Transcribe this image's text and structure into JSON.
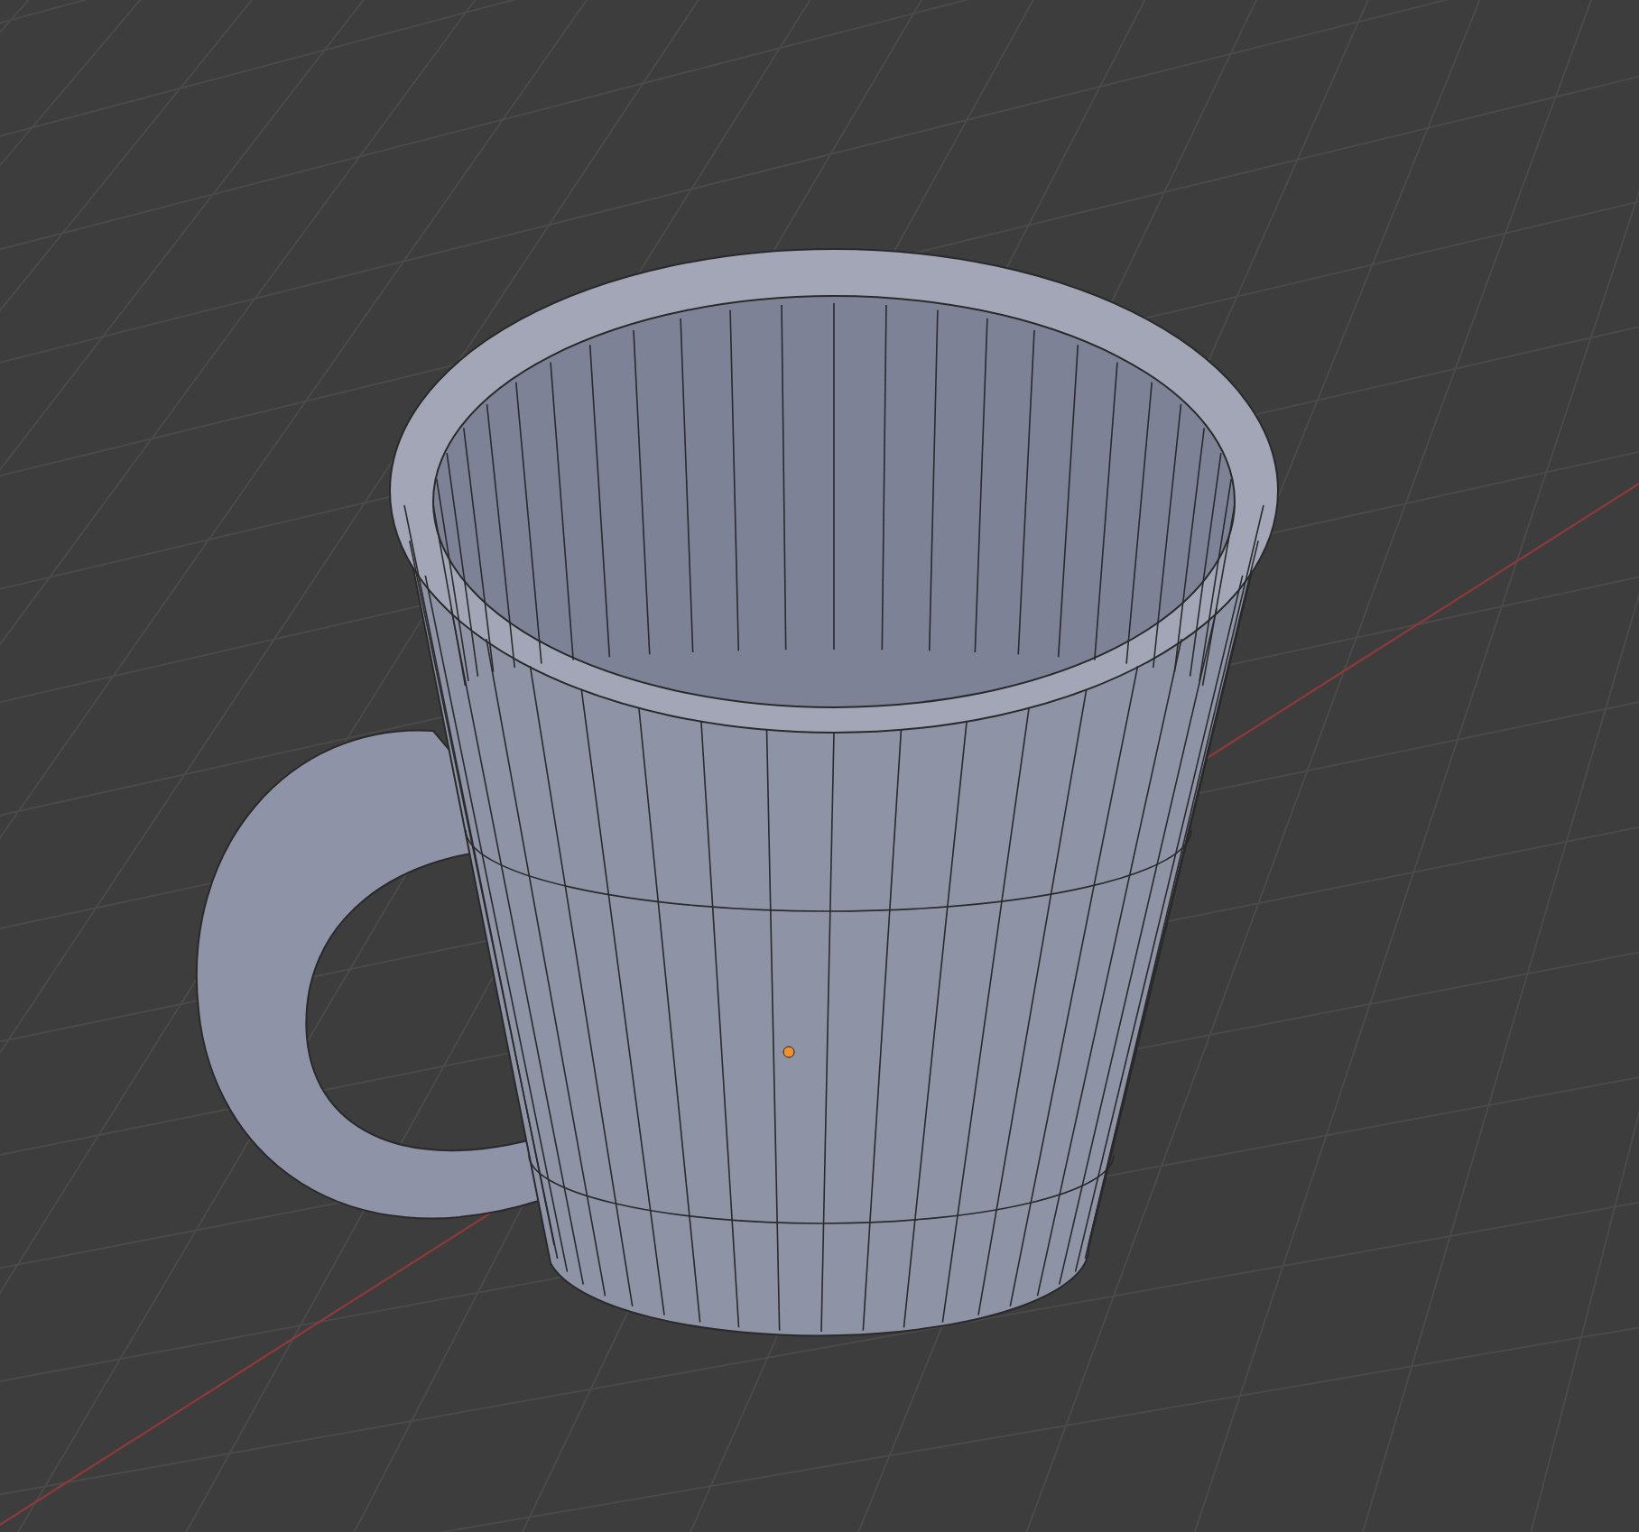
{
  "viewport": {
    "show_grid": true,
    "show_x_axis": true,
    "object_selected": true
  }
}
